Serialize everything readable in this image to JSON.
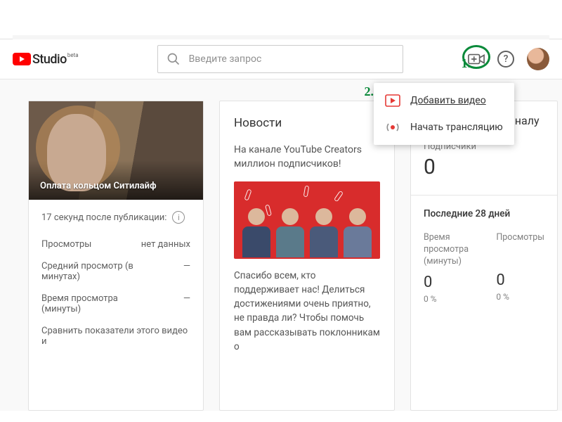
{
  "app": {
    "brand": "Studio",
    "beta": "beta"
  },
  "search": {
    "placeholder": "Введите запрос"
  },
  "create_menu": {
    "upload": "Добавить видео",
    "live": "Начать трансляцию"
  },
  "annotations": {
    "one": "1.",
    "two": "2."
  },
  "video_card": {
    "thumb_title": "Оплата кольцом Ситилайф",
    "post_time": "17 секунд после публикации:",
    "stats": [
      {
        "label": "Просмотры",
        "value": "нет данных"
      },
      {
        "label": "Средний просмотр (в минутах)",
        "value": "—"
      },
      {
        "label": "Время просмотра (минуты)",
        "value": "—"
      }
    ],
    "compare": "Сравнить показатели этого видео и"
  },
  "news": {
    "title": "Новости",
    "headline": "На канале YouTube Creators миллион подписчиков!",
    "body": "Спасибо всем, кто поддерживает нас! Делиться достижениями очень приятно, не правда ли? Чтобы помочь вам рассказывать поклонникам о"
  },
  "channel": {
    "title": "Статистика по каналу",
    "subs_label": "Подписчики",
    "subs_value": "0",
    "last28": "Последние 28 дней",
    "metrics": [
      {
        "label": "Время просмотра (минуты)",
        "value": "0",
        "pct": "0 %"
      },
      {
        "label": "Просмотры",
        "value": "0",
        "pct": "0 %"
      }
    ]
  }
}
